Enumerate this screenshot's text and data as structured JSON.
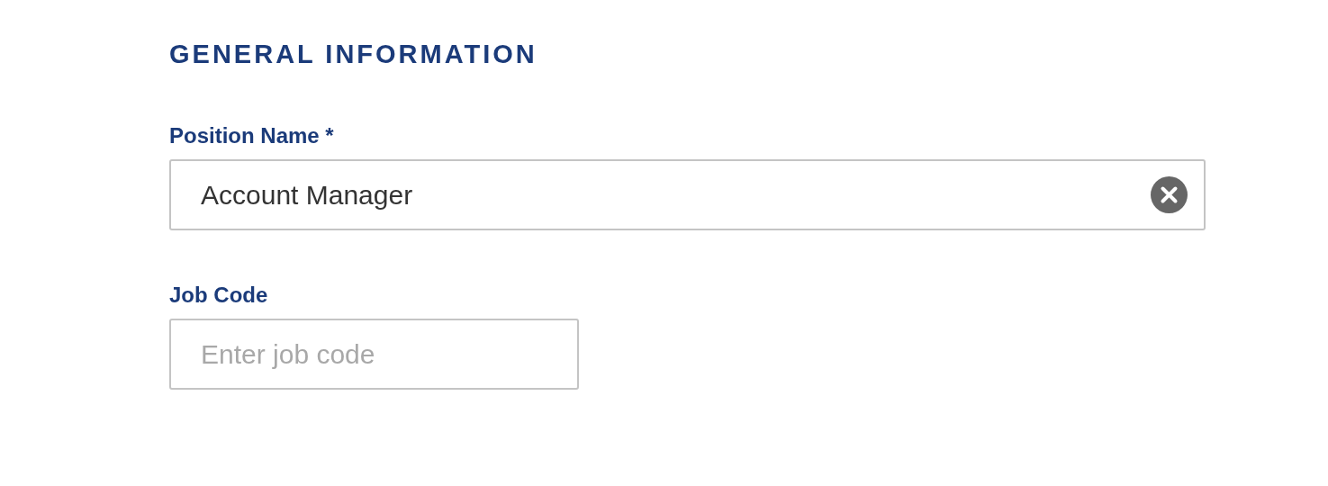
{
  "section": {
    "title": "GENERAL INFORMATION"
  },
  "fields": [
    {
      "kind": "long",
      "label": "Position Name *",
      "value": "Account Manager",
      "clearable": true
    },
    {
      "kind": "short",
      "label": "Job Code",
      "placeholder": "Enter job code",
      "clearable": false
    }
  ]
}
